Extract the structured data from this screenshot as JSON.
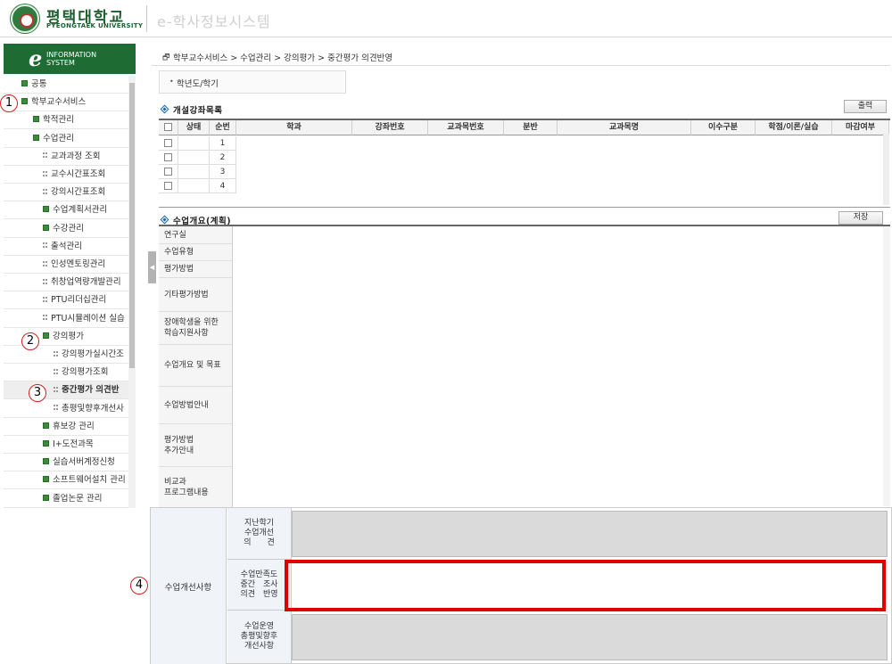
{
  "header": {
    "logo_kr": "평택대학교",
    "logo_en": "PYEONGTAEK UNIVERSITY",
    "system_title": "e-학사정보시스템"
  },
  "sidebar": {
    "banner_e": "e",
    "banner_line1": "INFORMATION",
    "banner_line2": "SYSTEM",
    "items": [
      {
        "label": "공통",
        "level": 1,
        "icon": "box"
      },
      {
        "label": "학부교수서비스",
        "level": 1,
        "icon": "box"
      },
      {
        "label": "학적관리",
        "level": 2,
        "icon": "box"
      },
      {
        "label": "수업관리",
        "level": 2,
        "icon": "box"
      },
      {
        "label": "교과과정 조회",
        "level": 3,
        "icon": "dot"
      },
      {
        "label": "교수시간표조회",
        "level": 3,
        "icon": "dot"
      },
      {
        "label": "강의시간표조회",
        "level": 3,
        "icon": "dot"
      },
      {
        "label": "수업계획서관리",
        "level": 3,
        "icon": "box"
      },
      {
        "label": "수강관리",
        "level": 3,
        "icon": "box"
      },
      {
        "label": "출석관리",
        "level": 3,
        "icon": "dot"
      },
      {
        "label": "인성멘토링관리",
        "level": 3,
        "icon": "dot"
      },
      {
        "label": "취창업역량개발관리",
        "level": 3,
        "icon": "dot"
      },
      {
        "label": "PTU리더십관리",
        "level": 3,
        "icon": "dot"
      },
      {
        "label": "PTU시뮬레이션 실습",
        "level": 3,
        "icon": "dot"
      },
      {
        "label": "강의평가",
        "level": 3,
        "icon": "box"
      },
      {
        "label": "강의평가실시간조",
        "level": 4,
        "icon": "dot"
      },
      {
        "label": "강의평가조회",
        "level": 4,
        "icon": "dot"
      },
      {
        "label": "중간평가 의견반",
        "level": 4,
        "icon": "dot",
        "active": true
      },
      {
        "label": "총평및향후개선사",
        "level": 4,
        "icon": "dot"
      },
      {
        "label": "휴보강 관리",
        "level": 3,
        "icon": "box"
      },
      {
        "label": "I+도전과목",
        "level": 3,
        "icon": "box"
      },
      {
        "label": "실습서버계정신청",
        "level": 3,
        "icon": "box"
      },
      {
        "label": "소프트웨어설치 관리",
        "level": 3,
        "icon": "box"
      },
      {
        "label": "졸업논문 관리",
        "level": 3,
        "icon": "box"
      }
    ]
  },
  "markers": [
    "1",
    "2",
    "3",
    "4"
  ],
  "breadcrumb": "학부교수서비스 > 수업관리 > 강의평가 > 중간평가 의견반영",
  "term_label": "학년도/학기",
  "course_section": {
    "title": "개설강좌목록",
    "print_button": "출력",
    "columns": [
      "상태",
      "순번",
      "학과",
      "강좌번호",
      "교과목번호",
      "분반",
      "교과목명",
      "이수구분",
      "학점/이론/실습",
      "마감여부"
    ],
    "rows": [
      "1",
      "2",
      "3",
      "4"
    ]
  },
  "plan_section": {
    "title": "수업개요(계획)",
    "save_button": "저장",
    "labels": [
      "연구실",
      "수업유형",
      "평가방법",
      "기타평가방법",
      "장애학생을 위한\n학습지원사항",
      "수업개요 및 목표",
      "수업방법안내",
      "평가방법\n추가안내",
      "비교과\n프로그램내용"
    ]
  },
  "improvement": {
    "label": "수업개선사항",
    "rows": [
      {
        "label": "지난학기\n수업개선\n의　　견"
      },
      {
        "label": "수업만족도\n중간　조사\n의견　반영"
      },
      {
        "label": "수업운영\n총평및향후\n개선사항"
      }
    ]
  },
  "colors": {
    "brand_green": "#1f6b34",
    "highlight_red": "#e00000"
  }
}
